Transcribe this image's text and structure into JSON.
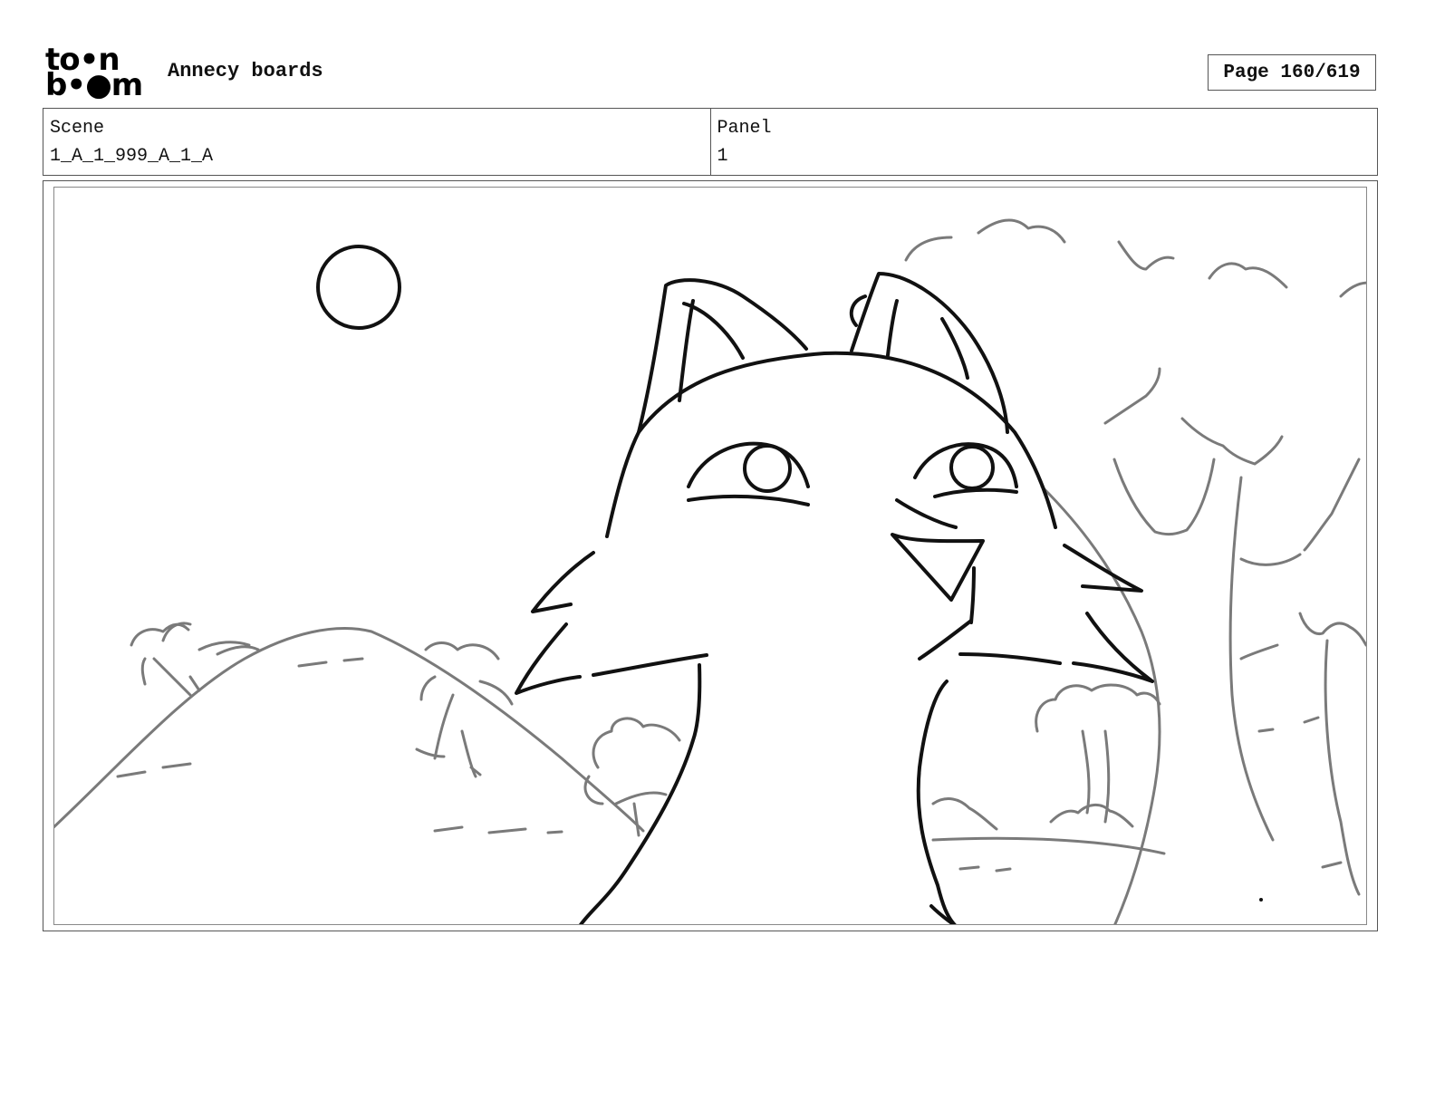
{
  "header": {
    "logo_line1": "to•n",
    "logo_line2": "b•●m",
    "project_title": "Annecy boards",
    "page_indicator": "Page 160/619"
  },
  "info": {
    "scene_label": "Scene",
    "scene_value": "1_A_1_999_A_1_A",
    "panel_label": "Panel",
    "panel_value": "1"
  },
  "colors": {
    "ink": "#111111",
    "sketch_grey": "#7a7a7a",
    "border": "#555555"
  }
}
